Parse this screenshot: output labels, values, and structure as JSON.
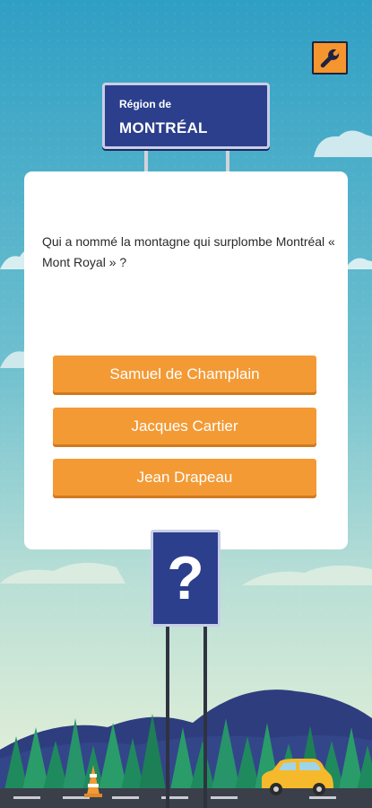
{
  "settings": {
    "icon": "wrench-icon"
  },
  "region_sign": {
    "line1": "Région de",
    "line2": "MONTRÉAL"
  },
  "question": {
    "text": "Qui a nommé la montagne qui surplombe Montréal « Mont Royal » ?"
  },
  "answers": [
    {
      "label": "Samuel de Champlain"
    },
    {
      "label": "Jacques Cartier"
    },
    {
      "label": "Jean Drapeau"
    }
  ],
  "mystery_sign": {
    "symbol": "?"
  },
  "colors": {
    "sky_top": "#2f9fc4",
    "sky_bottom": "#e8f1d9",
    "accent_orange": "#f39a35",
    "sign_blue": "#2c3f8d"
  }
}
